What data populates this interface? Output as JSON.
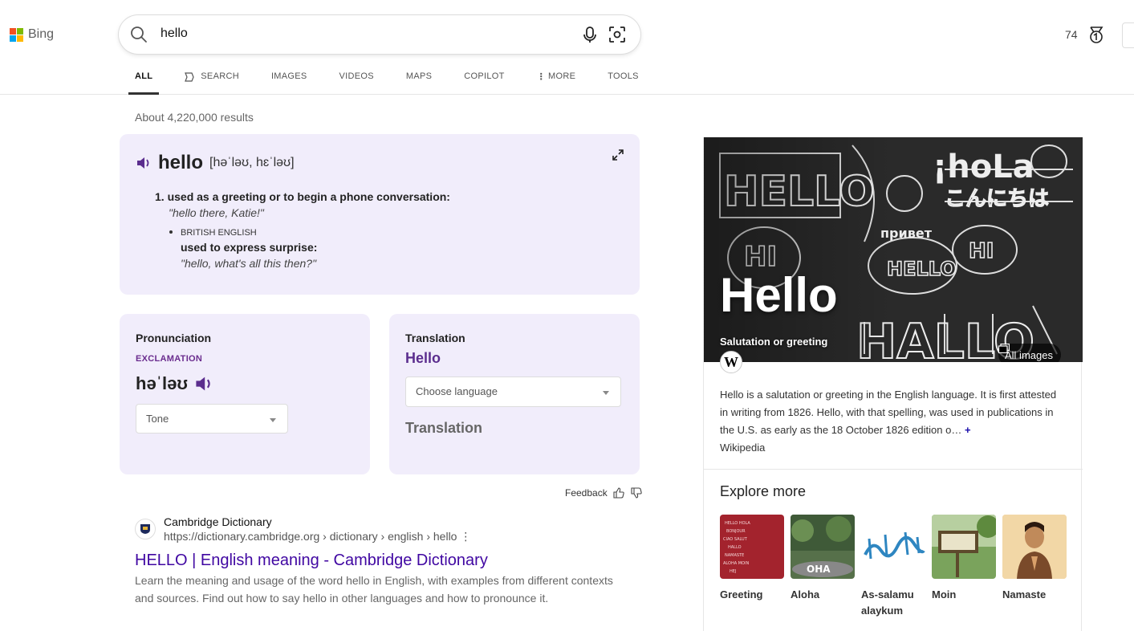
{
  "header": {
    "logo_text": "Bing",
    "search_query": "hello",
    "rewards_count": "74"
  },
  "tabs": [
    {
      "label": "ALL"
    },
    {
      "label": "SEARCH"
    },
    {
      "label": "IMAGES"
    },
    {
      "label": "VIDEOS"
    },
    {
      "label": "MAPS"
    },
    {
      "label": "COPILOT"
    },
    {
      "label": "MORE"
    },
    {
      "label": "TOOLS"
    }
  ],
  "results_count": "About 4,220,000 results",
  "dictionary": {
    "word": "hello",
    "pronunciation": "[həˈləʊ, hɛˈləʊ]",
    "definition_1": "1. used as a greeting or to begin a phone conversation:",
    "example_1": "\"hello there, Katie!\"",
    "region": "BRITISH ENGLISH",
    "definition_2": "used to express surprise:",
    "example_2": "\"hello, what's all this then?\""
  },
  "pronunciation_card": {
    "title": "Pronunciation",
    "part_of_speech": "EXCLAMATION",
    "ipa": "həˈləʊ",
    "tone_select": "Tone"
  },
  "translation_card": {
    "title": "Translation",
    "word": "Hello",
    "language_select": "Choose language",
    "output": "Translation"
  },
  "feedback_label": "Feedback",
  "result": {
    "site_name": "Cambridge Dictionary",
    "url": "https://dictionary.cambridge.org › dictionary › english › hello",
    "title": "HELLO | English meaning - Cambridge Dictionary",
    "snippet": "Learn the meaning and usage of the word hello in English, with examples from different contexts and sources. Find out how to say hello in other languages and how to pronounce it."
  },
  "knowledge_panel": {
    "title": "Hello",
    "subtitle": "Salutation or greeting",
    "all_images": "All images",
    "description": "Hello is a salutation or greeting in the English language. It is first attested in writing from 1826. Hello, with that spelling, was used in publications in the U.S. as early as the 18 October 1826 edition o…",
    "source": "Wikipedia",
    "explore_title": "Explore more",
    "explore_items": [
      {
        "label": "Greeting"
      },
      {
        "label": "Aloha"
      },
      {
        "label": "As-salamu alaykum"
      },
      {
        "label": "Moin"
      },
      {
        "label": "Namaste"
      }
    ]
  },
  "colors": {
    "card_bg": "#f1edfb",
    "accent_purple": "#5b2d8e",
    "link_purple": "#4007a2"
  }
}
